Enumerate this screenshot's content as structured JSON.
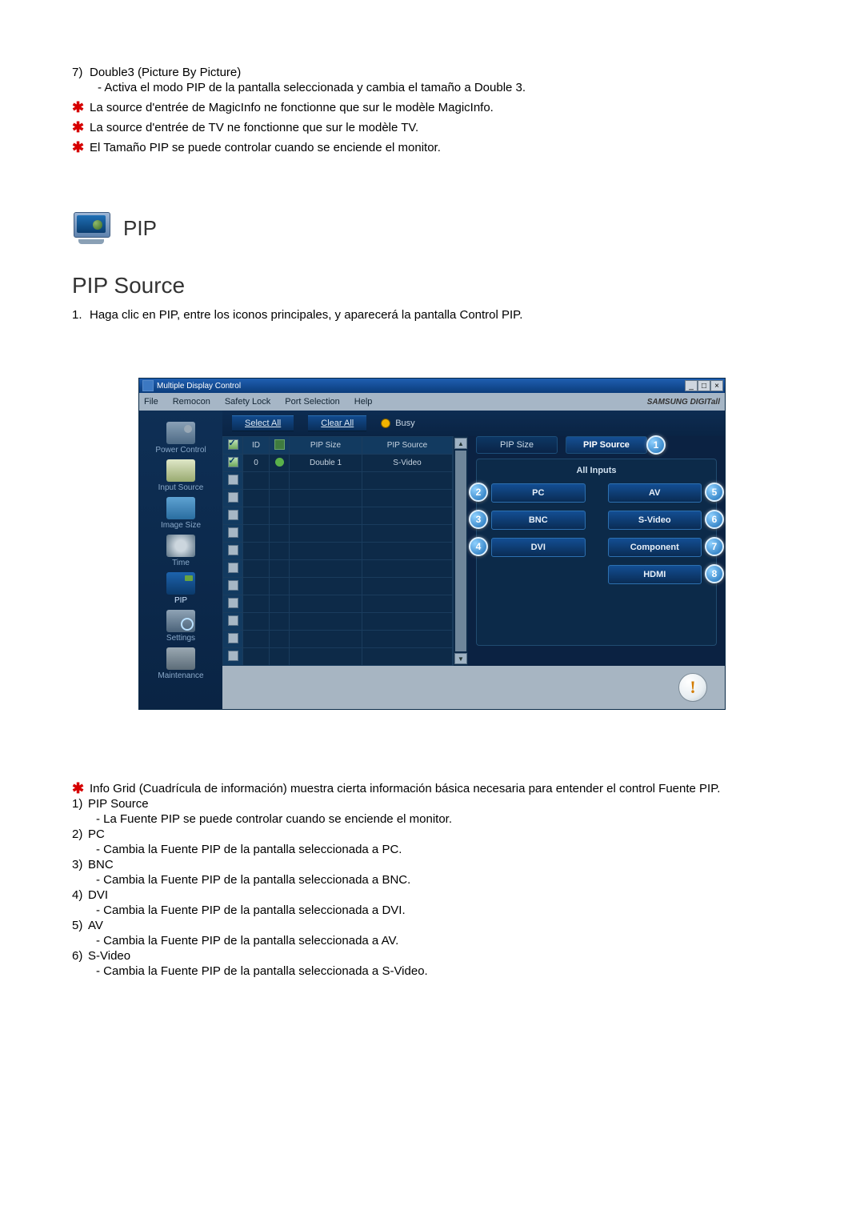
{
  "intro": {
    "item7_num": "7)",
    "item7_title": "Double3 (Picture By Picture)",
    "item7_detail": "- Activa el modo PIP de la pantalla seleccionada y cambia el tamaño a Double 3.",
    "note1": "La source d'entrée de MagicInfo ne fonctionne que sur le modèle MagicInfo.",
    "note2": "La source d'entrée de TV ne fonctionne que sur le modèle TV.",
    "note3": "El Tamaño PIP se puede controlar cuando se enciende el monitor."
  },
  "pip_header": "PIP",
  "section": {
    "title": "PIP Source",
    "step_num": "1.",
    "step_text": "Haga clic en PIP, entre los iconos principales, y aparecerá la pantalla Control PIP."
  },
  "app": {
    "window_title": "Multiple Display Control",
    "menus": {
      "file": "File",
      "remocon": "Remocon",
      "safety": "Safety Lock",
      "port": "Port Selection",
      "help": "Help"
    },
    "brand": "SAMSUNG DIGITall",
    "sidebar": {
      "power": "Power Control",
      "input": "Input Source",
      "image": "Image Size",
      "time": "Time",
      "pip": "PIP",
      "settings": "Settings",
      "maintenance": "Maintenance"
    },
    "toolbar": {
      "select_all": "Select All",
      "clear_all": "Clear All",
      "busy": "Busy"
    },
    "grid": {
      "head_chk": " ",
      "head_id": "ID",
      "head_status": " ",
      "head_pipsize": "PIP Size",
      "head_pipsource": "PIP Source",
      "row_id": "0",
      "row_pipsize": "Double 1",
      "row_pipsource": "S-Video"
    },
    "right": {
      "tab_size": "PIP Size",
      "tab_source": "PIP Source",
      "box_title": "All Inputs",
      "btns": {
        "pc": "PC",
        "av": "AV",
        "bnc": "BNC",
        "svideo": "S-Video",
        "dvi": "DVI",
        "component": "Component",
        "hdmi": "HDMI"
      }
    },
    "callouts": {
      "c1": "1",
      "c2": "2",
      "c3": "3",
      "c4": "4",
      "c5": "5",
      "c6": "6",
      "c7": "7",
      "c8": "8"
    },
    "win_min": "_",
    "win_max": "□",
    "win_close": "×",
    "scroll_up": "▲",
    "scroll_down": "▼"
  },
  "footer": {
    "star_note": "Info Grid (Cuadrícula de información) muestra cierta información básica necesaria para entender el control Fuente PIP.",
    "i1_num": "1)",
    "i1_title": "PIP Source",
    "i1_detail": "- La Fuente PIP se puede controlar cuando se enciende el monitor.",
    "i2_num": "2)",
    "i2_title": "PC",
    "i2_detail": "- Cambia la Fuente PIP de la pantalla seleccionada a PC.",
    "i3_num": "3)",
    "i3_title": "BNC",
    "i3_detail": "- Cambia la Fuente PIP de la pantalla seleccionada a BNC.",
    "i4_num": "4)",
    "i4_title": "DVI",
    "i4_detail": "- Cambia la Fuente PIP de la pantalla seleccionada a DVI.",
    "i5_num": "5)",
    "i5_title": "AV",
    "i5_detail": "- Cambia la Fuente PIP de la pantalla seleccionada a AV.",
    "i6_num": "6)",
    "i6_title": "S-Video",
    "i6_detail": "- Cambia la Fuente PIP de la pantalla seleccionada a S-Video."
  }
}
